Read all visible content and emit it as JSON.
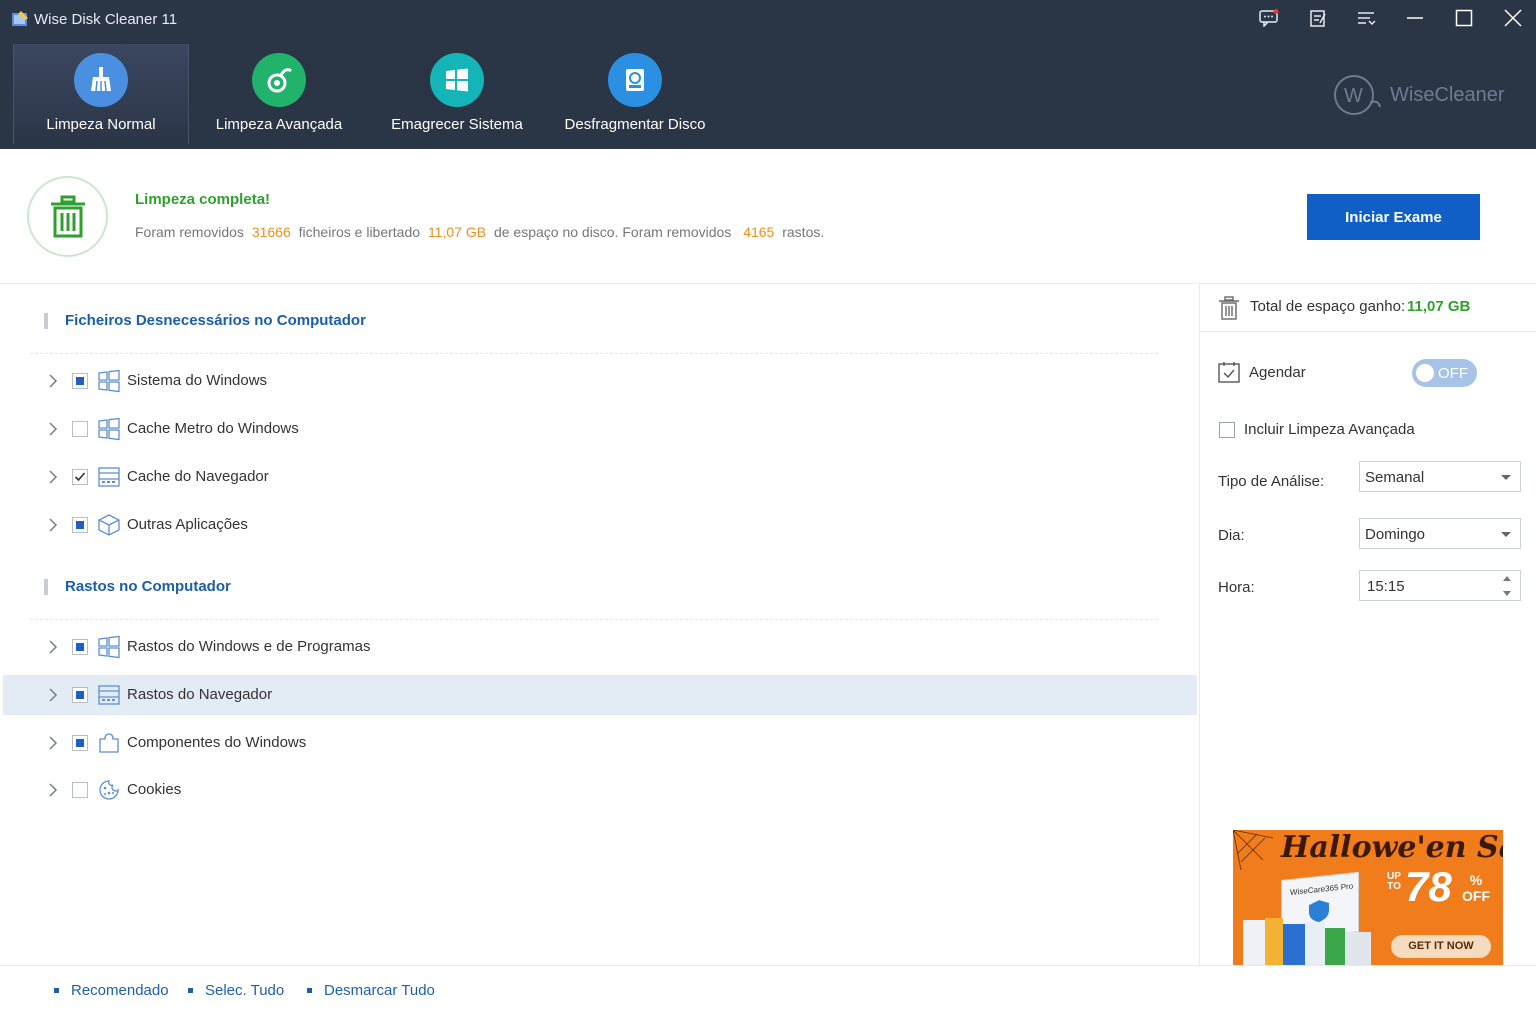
{
  "app": {
    "title": "Wise Disk Cleaner 11",
    "brand": "WiseCleaner"
  },
  "nav": [
    {
      "label": "Limpeza Normal",
      "color": "#4a8fe0"
    },
    {
      "label": "Limpeza Avançada",
      "color": "#21b36c"
    },
    {
      "label": "Emagrecer Sistema",
      "color": "#13b5b9"
    },
    {
      "label": "Desfragmentar Disco",
      "color": "#2b8fe2"
    }
  ],
  "status": {
    "title": "Limpeza completa!",
    "p1": "Foram removidos",
    "files": "31666",
    "p2": "ficheiros e libertado",
    "size": "11,07 GB",
    "p3": "de espaço no disco. Foram removidos",
    "traces": "4165",
    "p4": "rastos.",
    "scan_button": "Iniciar Exame"
  },
  "sections": [
    {
      "title": "Ficheiros Desnecessários no Computador",
      "items": [
        {
          "label": "Sistema do Windows",
          "state": "partial",
          "icon": "windows-icon"
        },
        {
          "label": "Cache Metro do Windows",
          "state": "unchecked",
          "icon": "windows-icon"
        },
        {
          "label": "Cache do Navegador",
          "state": "checked",
          "icon": "browser-icon"
        },
        {
          "label": "Outras Aplicações",
          "state": "partial",
          "icon": "box-icon"
        }
      ]
    },
    {
      "title": "Rastos no Computador",
      "items": [
        {
          "label": "Rastos do Windows e de Programas",
          "state": "partial",
          "icon": "windows-icon"
        },
        {
          "label": "Rastos do Navegador",
          "state": "partial",
          "icon": "browser-icon",
          "highlighted": true
        },
        {
          "label": "Componentes do Windows",
          "state": "partial",
          "icon": "puzzle-icon"
        },
        {
          "label": "Cookies",
          "state": "unchecked",
          "icon": "cookie-icon"
        }
      ]
    }
  ],
  "right": {
    "total_label": "Total de espaço ganho:",
    "total_value": "11,07 GB",
    "schedule_label": "Agendar",
    "toggle_label": "OFF",
    "include_label": "Incluir Limpeza Avançada",
    "type_label": "Tipo de Análise:",
    "type_value": "Semanal",
    "day_label": "Dia:",
    "day_value": "Domingo",
    "hour_label": "Hora:",
    "hour_value": "15:15"
  },
  "promo": {
    "title": "Hallowe'en Sale",
    "upto": "UP TO",
    "percent": "78",
    "off": "% OFF",
    "product": "WiseCare365 Pro",
    "button": "GET IT NOW"
  },
  "bottom": {
    "recommended": "Recomendado",
    "select_all": "Selec. Tudo",
    "deselect_all": "Desmarcar Tudo"
  }
}
